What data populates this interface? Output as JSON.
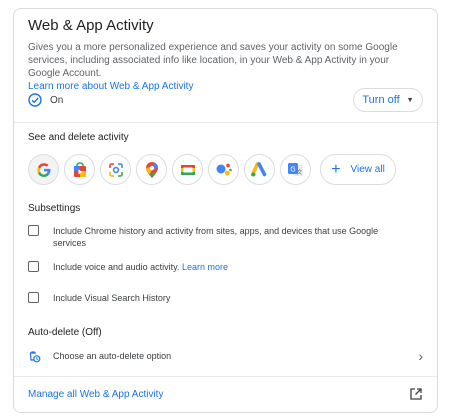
{
  "header": {
    "title": "Web & App Activity",
    "description": "Gives you a more personalized experience and saves your activity on some Google services, including associated info like location, in your Web & App Activity in your Google Account.",
    "learn_more": "Learn more about Web & App Activity"
  },
  "status": {
    "icon": "check-circle-icon",
    "text": "On",
    "turn_off_label": "Turn off"
  },
  "see_delete": {
    "label": "See and delete activity",
    "apps": [
      {
        "name": "google-search",
        "icon": "google-g-icon"
      },
      {
        "name": "google-play",
        "icon": "play-store-icon"
      },
      {
        "name": "google-lens",
        "icon": "lens-icon"
      },
      {
        "name": "google-maps",
        "icon": "maps-pin-icon"
      },
      {
        "name": "google-tv",
        "icon": "tv-icon"
      },
      {
        "name": "google-assistant",
        "icon": "assistant-icon"
      },
      {
        "name": "google-ads",
        "icon": "ads-icon"
      },
      {
        "name": "google-translate",
        "icon": "translate-icon"
      }
    ],
    "view_all": "View all"
  },
  "subsettings": {
    "label": "Subsettings",
    "items": [
      {
        "text": "Include Chrome history and activity from sites, apps, and devices that use Google services",
        "checked": false
      },
      {
        "text": "Include voice and audio activity.",
        "link": "Learn more",
        "checked": false
      },
      {
        "text": "Include Visual Search History",
        "checked": false
      }
    ]
  },
  "auto_delete": {
    "label": "Auto-delete (Off)",
    "option": "Choose an auto-delete option"
  },
  "footer": {
    "manage_link": "Manage all Web & App Activity"
  },
  "colors": {
    "accent": "#1a73e8",
    "text": "#202124",
    "secondary": "#5f6368",
    "border": "#dadce0"
  }
}
